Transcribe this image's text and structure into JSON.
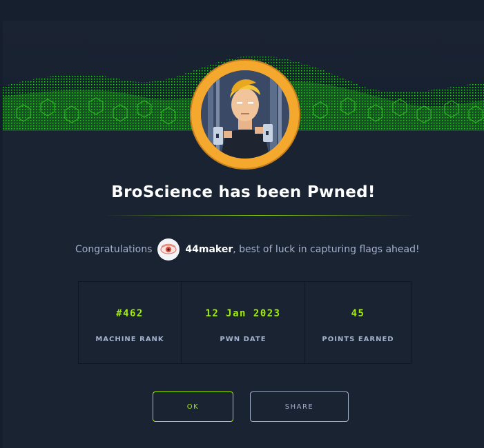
{
  "modal": {
    "title": "BroScience has been Pwned!",
    "congrats_prefix": "Congratulations",
    "username": "44maker",
    "congrats_suffix": ", best of luck in capturing flags ahead!"
  },
  "stats": [
    {
      "value": "#462",
      "label": "MACHINE RANK"
    },
    {
      "value": "12 Jan 2023",
      "label": "PWN DATE"
    },
    {
      "value": "45",
      "label": "POINTS EARNED"
    }
  ],
  "buttons": {
    "ok_label": "OK",
    "share_label": "SHARE"
  },
  "colors": {
    "accent": "#9fef00",
    "background": "#1a2332",
    "avatar_ring": "#f4a92e",
    "muted_text": "#a4b1cd"
  },
  "icons": {
    "machine_avatar": "machine-avatar-icon",
    "user_avatar": "user-avatar-icon"
  }
}
